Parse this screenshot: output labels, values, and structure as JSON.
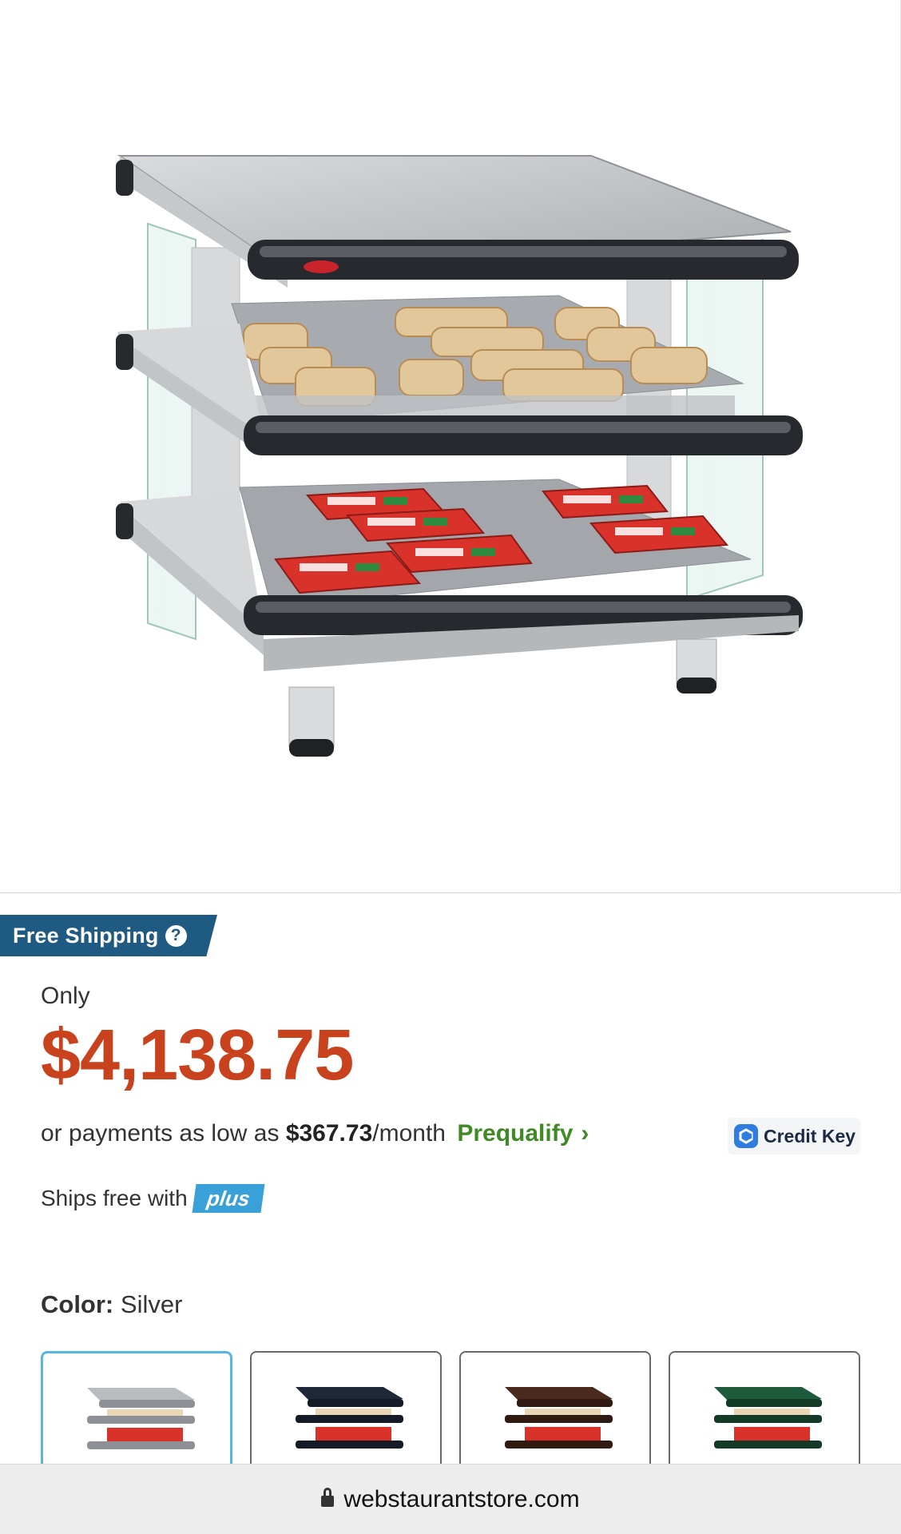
{
  "page": {
    "url": "webstaurantstore.com"
  },
  "product_image": {
    "icon": "heated-display-merchandiser"
  },
  "shipping_tag": {
    "label": "Free Shipping",
    "help_icon": "?"
  },
  "pricing": {
    "prefix": "Only",
    "price": "$4,138.75",
    "payments_text": "or payments as low as",
    "monthly_amount": "$367.73",
    "monthly_suffix": "/month",
    "prequalify_label": "Prequalify",
    "prequalify_chevron": "›",
    "credit_key_label": "Credit Key"
  },
  "ships_free": {
    "text": "Ships free with",
    "badge": "plus"
  },
  "color": {
    "label": "Color:",
    "selected": "Silver",
    "swatches": [
      {
        "name": "Silver",
        "hex": "#b9bcbf",
        "selected": true
      },
      {
        "name": "Navy",
        "hex": "#1f2838",
        "selected": false
      },
      {
        "name": "Brown",
        "hex": "#4a2a1c",
        "selected": false
      },
      {
        "name": "Green",
        "hex": "#1e5a3c",
        "selected": false
      }
    ]
  },
  "colors": {
    "price_red": "#c8421d",
    "prequalify_green": "#3f8a25",
    "shipping_blue": "#1e5a82",
    "plus_blue": "#3aa0d8"
  }
}
